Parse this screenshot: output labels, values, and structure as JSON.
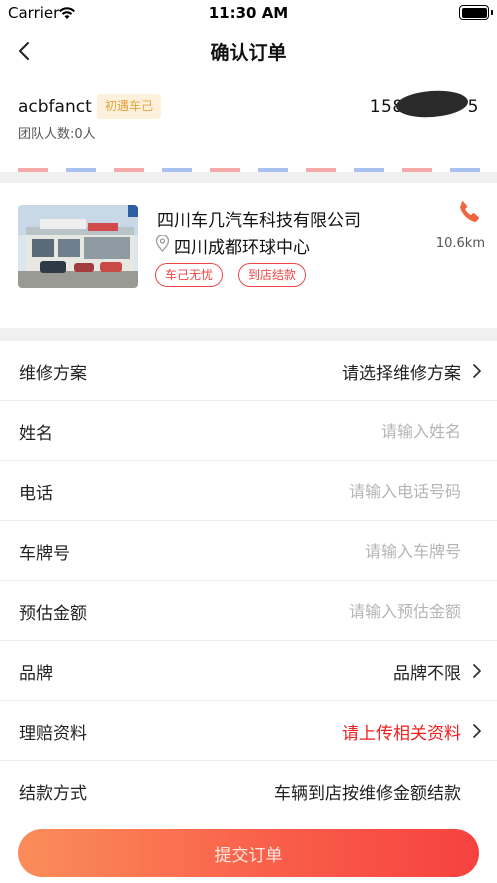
{
  "status_bar": {
    "carrier": "Carrier",
    "time": "11:30 AM"
  },
  "nav": {
    "title": "确认订单"
  },
  "user": {
    "name": "acbfanct",
    "tag": "初遇车己",
    "team_count": "团队人数:0人",
    "phone_prefix": "158",
    "phone_suffix": "5"
  },
  "shop": {
    "name": "四川车几汽车科技有限公司",
    "address": "四川成都环球中心",
    "tags": [
      "车己无忧",
      "到店结款"
    ],
    "distance": "10.6km"
  },
  "form": {
    "repair_plan": {
      "label": "维修方案",
      "value": "请选择维修方案"
    },
    "name": {
      "label": "姓名",
      "placeholder": "请输入姓名"
    },
    "phone": {
      "label": "电话",
      "placeholder": "请输入电话号码"
    },
    "plate": {
      "label": "车牌号",
      "placeholder": "请输入车牌号"
    },
    "estimate": {
      "label": "预估金额",
      "placeholder": "请输入预估金额"
    },
    "brand": {
      "label": "品牌",
      "value": "品牌不限"
    },
    "claim": {
      "label": "理赔资料",
      "value": "请上传相关资料"
    },
    "payment": {
      "label": "结款方式",
      "value": "车辆到店按维修金额结款"
    }
  },
  "submit": {
    "label": "提交订单"
  },
  "colors": {
    "accent_red": "#f21d1d",
    "tag_orange": "#e6a23c",
    "button_start": "#fb8d5a",
    "button_end": "#f6423f"
  }
}
